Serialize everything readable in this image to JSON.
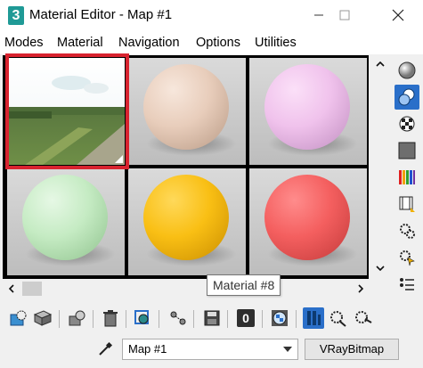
{
  "window": {
    "app_icon_text": "3",
    "title": "Material Editor - Map #1"
  },
  "menu": [
    "Modes",
    "Material",
    "Navigation",
    "Options",
    "Utilities"
  ],
  "slots": [
    {
      "kind": "image",
      "label": "landscape-bitmap"
    },
    {
      "kind": "sphere",
      "color": "#e8cdbb",
      "color_dark": "#b89a85"
    },
    {
      "kind": "sphere",
      "color": "#f0c2ec",
      "color_dark": "#c08ec0"
    },
    {
      "kind": "sphere",
      "color": "#c5ebc3",
      "color_dark": "#8fc28d"
    },
    {
      "kind": "sphere",
      "color": "#f9bf14",
      "color_dark": "#c98d00"
    },
    {
      "kind": "sphere",
      "color": "#f45f5f",
      "color_dark": "#c23a3a"
    }
  ],
  "tooltip": "Material #8",
  "toolbar": {
    "material_id_value": "0"
  },
  "status": {
    "map_name": "Map #1",
    "map_type": "VRayBitmap"
  },
  "colors": {
    "active_slot_border": "#d8232f",
    "accent_blue": "#2a6fc9"
  }
}
